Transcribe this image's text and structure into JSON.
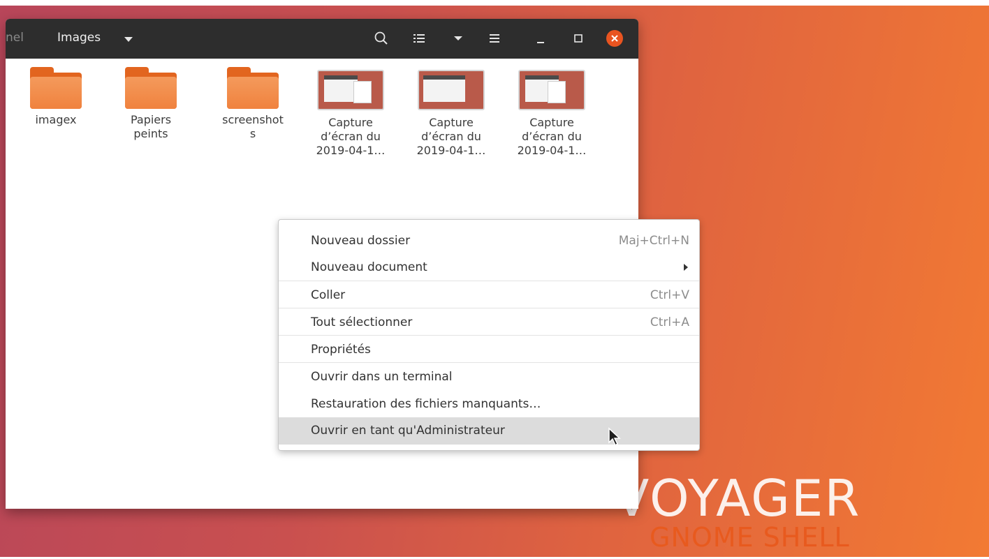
{
  "headerbar": {
    "breadcrumb_prev": "nel",
    "breadcrumb_current": "Images",
    "icons": [
      "search-icon",
      "list-view-icon",
      "view-options-chevron-icon",
      "hamburger-menu-icon",
      "minimize-icon",
      "maximize-icon",
      "close-icon"
    ]
  },
  "files": [
    {
      "type": "folder",
      "label": "imagex"
    },
    {
      "type": "folder",
      "label": "Papiers\npeints"
    },
    {
      "type": "folder",
      "label": "screenshot\ns"
    },
    {
      "type": "image",
      "label": "Capture\nd’écran du\n2019-04-1…"
    },
    {
      "type": "image",
      "label": "Capture\nd’écran du\n2019-04-1…"
    },
    {
      "type": "image",
      "label": "Capture\nd’écran du\n2019-04-1…"
    }
  ],
  "context_menu": {
    "items": [
      {
        "label": "Nouveau dossier",
        "accel": "Maj+Ctrl+N"
      },
      {
        "label": "Nouveau document",
        "accel": ""
      },
      {
        "label": "Coller",
        "accel": "Ctrl+V"
      },
      {
        "label": "Tout sélectionner",
        "accel": "Ctrl+A"
      },
      {
        "label": "Propriétés",
        "accel": ""
      },
      {
        "label": "Ouvrir dans un terminal",
        "accel": ""
      },
      {
        "label": "Restauration des fichiers manquants…",
        "accel": ""
      },
      {
        "label": "Ouvrir en tant qu'Administrateur",
        "accel": ""
      }
    ]
  },
  "wallpaper": {
    "brand_main": "VOYAGER",
    "brand_sub": "GNOME SHELL"
  },
  "colors": {
    "accent": "#e95420",
    "folder": "#f0823e",
    "headerbar": "#2d2d2d"
  }
}
